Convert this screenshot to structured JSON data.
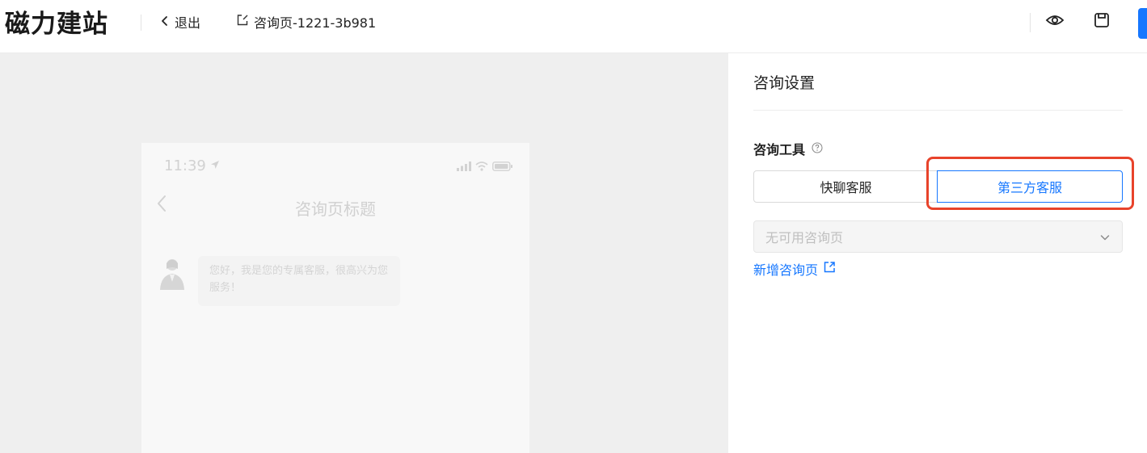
{
  "header": {
    "brand": "磁力建站",
    "exit_label": "退出",
    "doc_title": "咨询页-1221-3b981",
    "icons": [
      "chevron-left-icon",
      "edit-icon",
      "eye-icon",
      "save-icon"
    ]
  },
  "preview": {
    "time": "11:39",
    "title": "咨询页标题",
    "message": "您好，我是您的专属客服，很高兴为您服务！"
  },
  "panel": {
    "title": "咨询设置",
    "tool_label": "咨询工具",
    "tabs": [
      {
        "label": "快聊客服",
        "selected": false
      },
      {
        "label": "第三方客服",
        "selected": true
      }
    ],
    "select_placeholder": "无可用咨询页",
    "add_link": "新增咨询页"
  },
  "colors": {
    "accent": "#1677ff",
    "highlight": "#e8432b"
  }
}
